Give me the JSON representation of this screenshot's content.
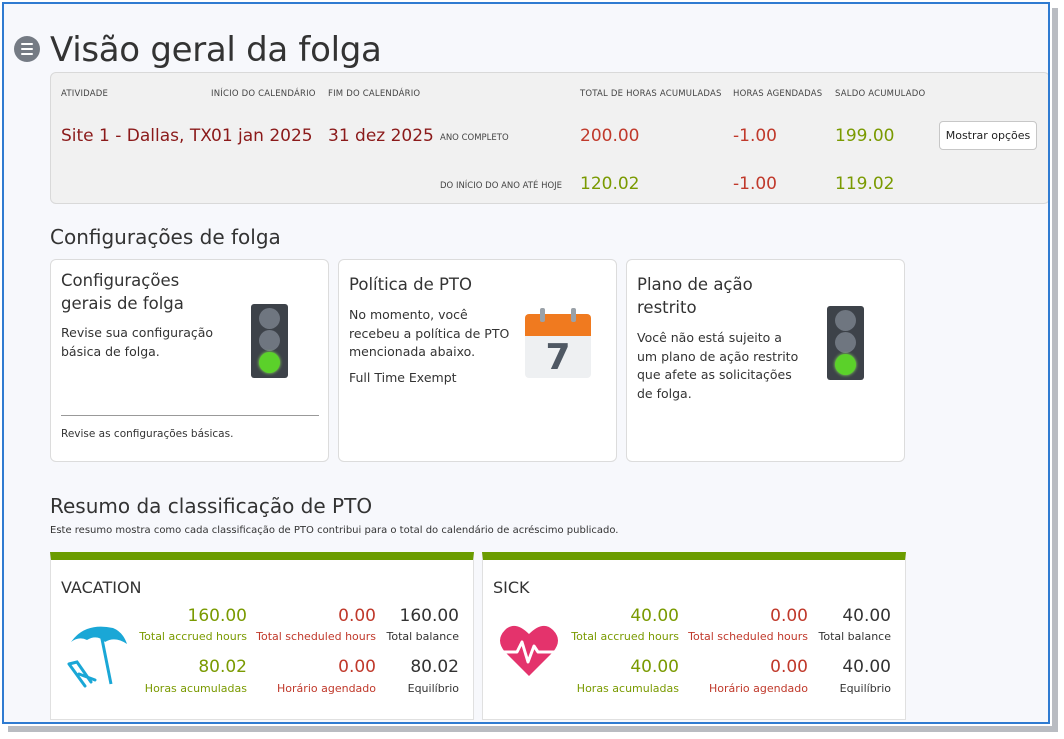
{
  "page_title": "Visão geral da folga",
  "summary": {
    "headers": {
      "activity": "ATIVIDADE",
      "calendar_start": "INÍCIO DO CALENDÁRIO",
      "calendar_end": "FIM DO CALENDÁRIO",
      "total_accrued": "TOTAL DE HORAS ACUMULADAS",
      "scheduled": "HORAS AGENDADAS",
      "balance": "SALDO ACUMULADO"
    },
    "site": "Site 1 - Dallas, TX",
    "start_date": "01 jan 2025",
    "end_date": "31 dez 2025",
    "full_year": {
      "label": "ANO COMPLETO",
      "accrued": "200.00",
      "scheduled": "-1.00",
      "balance": "199.00"
    },
    "ytd": {
      "label": "DO INÍCIO DO ANO ATÉ HOJE",
      "accrued": "120.02",
      "scheduled": "-1.00",
      "balance": "119.02"
    },
    "options_button": "Mostrar opções"
  },
  "settings": {
    "section_title": "Configurações de folga",
    "general": {
      "title_line1": "Configurações",
      "title_line2": "gerais de folga",
      "text_line1": "Revise sua configuração",
      "text_line2": "básica de folga.",
      "link": "Revise as configurações básicas.",
      "icon": "traffic-light-green-icon"
    },
    "policy": {
      "title": "Política de PTO",
      "text_line1": "No momento, você",
      "text_line2": "recebeu a política de PTO",
      "text_line3": "mencionada abaixo.",
      "policy_name": "Full Time Exempt",
      "calendar_day": "7",
      "icon": "calendar-icon"
    },
    "restricted": {
      "title_line1": "Plano de ação",
      "title_line2": "restrito",
      "text_line1": "Você não está sujeito a",
      "text_line2": "um plano de ação restrito",
      "text_line3": "que afete as solicitações",
      "text_line4": "de folga.",
      "icon": "traffic-light-green-icon"
    }
  },
  "pto_summary": {
    "section_title": "Resumo da classificação de PTO",
    "subtitle": "Este resumo mostra como cada classificação de PTO contribui para o total do calendário de acréscimo publicado.",
    "vacation": {
      "title": "VACATION",
      "icon": "beach-umbrella-icon",
      "total_accrued": "160.00",
      "total_accrued_label": "Total accrued hours",
      "total_scheduled": "0.00",
      "total_scheduled_label": "Total scheduled hours",
      "total_balance": "160.00",
      "total_balance_label": "Total balance",
      "accrued": "80.02",
      "accrued_label": "Horas acumuladas",
      "scheduled": "0.00",
      "scheduled_label": "Horário agendado",
      "balance": "80.02",
      "balance_label": "Equilíbrio"
    },
    "sick": {
      "title": "SICK",
      "icon": "heart-pulse-icon",
      "total_accrued": "40.00",
      "total_accrued_label": "Total accrued hours",
      "total_scheduled": "0.00",
      "total_scheduled_label": "Total scheduled hours",
      "total_balance": "40.00",
      "total_balance_label": "Total balance",
      "accrued": "40.00",
      "accrued_label": "Horas acumuladas",
      "scheduled": "0.00",
      "scheduled_label": "Horário agendado",
      "balance": "40.00",
      "balance_label": "Equilíbrio"
    }
  },
  "colors": {
    "accent_green": "#7a9a01",
    "accent_red": "#c0392b",
    "dark_red": "#8b1a1a",
    "pto_bar": "#6b9c00",
    "frame_border": "#2f7bd1"
  }
}
